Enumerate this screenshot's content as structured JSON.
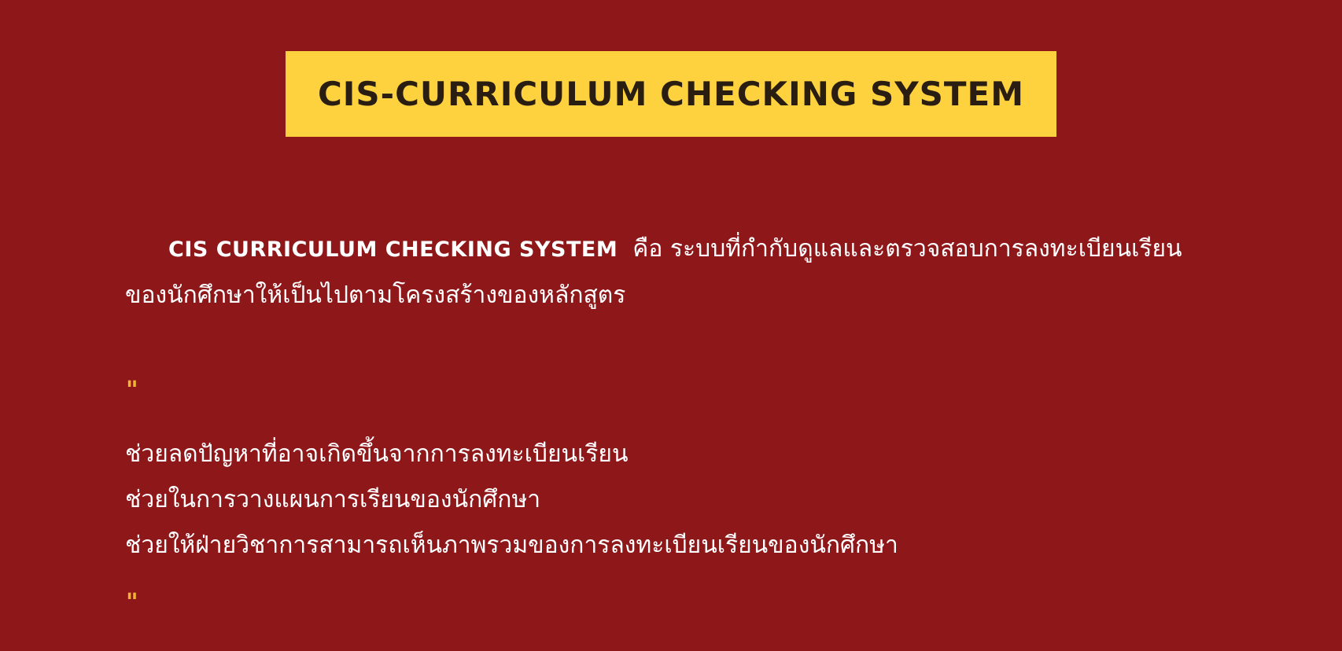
{
  "title": "CIS-CURRICULUM CHECKING SYSTEM",
  "intro": {
    "term": "CIS CURRICULUM CHECKING SYSTEM",
    "line1_rest": "คือ  ระบบที่กำกับดูแลและตรวจสอบการลงทะเบียนเรียน",
    "line2": "ของนักศึกษาให้เป็นไปตามโครงสร้างของหลักสูตร"
  },
  "quote": {
    "open": "\"",
    "close": "\""
  },
  "benefits": [
    "ช่วยลดปัญหาที่อาจเกิดขึ้นจากการลงทะเบียนเรียน",
    "ช่วยในการวางแผนการเรียนของนักศึกษา",
    "ช่วยให้ฝ่ายวิชาการสามารถเห็นภาพรวมของการลงทะเบียนเรียนของนักศึกษา"
  ],
  "colors": {
    "background": "#8e171a",
    "banner": "#fdd23e",
    "title_text": "#2a1d12",
    "quote_mark": "#f2b532",
    "body_text": "#ffffff"
  }
}
